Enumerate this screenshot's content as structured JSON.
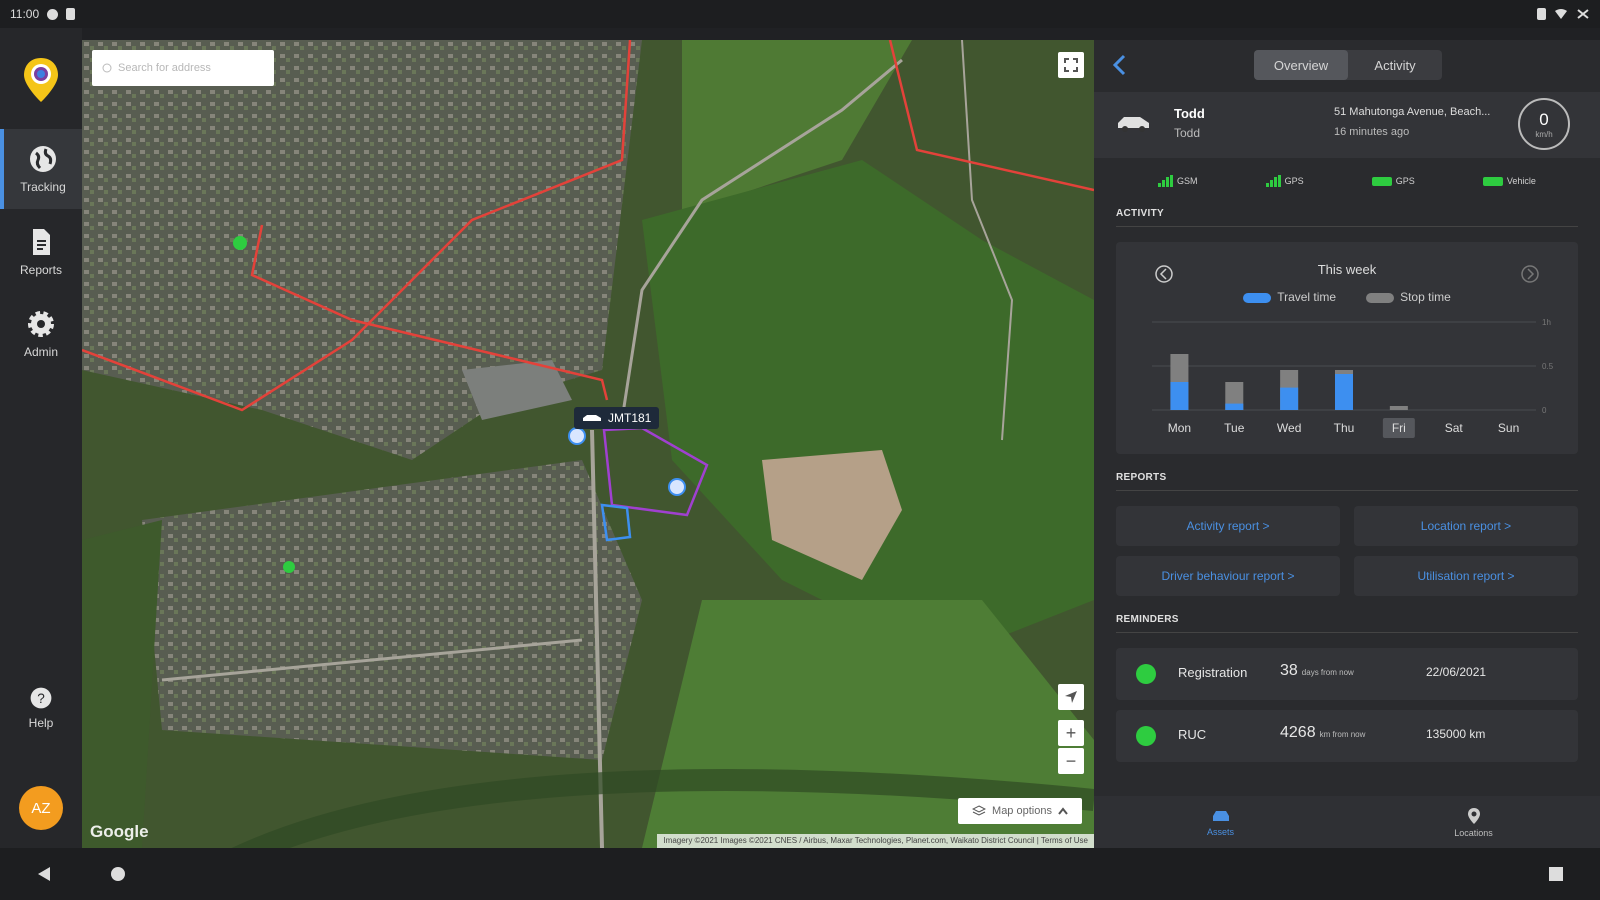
{
  "status_bar": {
    "time": "11:00"
  },
  "rail": {
    "items": [
      {
        "label": "Tracking",
        "icon": "globe-icon",
        "active": true
      },
      {
        "label": "Reports",
        "icon": "document-icon",
        "active": false
      },
      {
        "label": "Admin",
        "icon": "gear-icon",
        "active": false
      }
    ],
    "help": "Help",
    "avatar": "AZ"
  },
  "map": {
    "search_placeholder": "Search for address",
    "vehicle_label": "JMT181",
    "map_options": "Map options",
    "google": "Google",
    "attribution": "Imagery ©2021 Images ©2021 CNES / Airbus, Maxar Technologies, Planet.com, Waikato District Council | Terms of Use"
  },
  "panel": {
    "tabs": [
      "Overview",
      "Activity"
    ],
    "active_tab": "Overview",
    "vehicle": {
      "name": "Todd",
      "sub": "Todd",
      "address": "51 Mahutonga Avenue, Beach...",
      "updated": "16 minutes ago",
      "speed": "0",
      "speed_unit": "km/h"
    },
    "signals": [
      "GSM",
      "GPS",
      "GPS",
      "Vehicle"
    ],
    "activity_title": "ACTIVITY",
    "week_title": "This week",
    "legend": {
      "travel": "Travel time",
      "stop": "Stop time"
    },
    "reports_title": "REPORTS",
    "reports": [
      "Activity report >",
      "Location report >",
      "Driver behaviour report >",
      "Utilisation report >"
    ],
    "reminders_title": "REMINDERS",
    "reminders": [
      {
        "label": "Registration",
        "amount": "38",
        "amount_unit": "days from now",
        "date": "22/06/2021"
      },
      {
        "label": "RUC",
        "amount": "4268",
        "amount_unit": "km from now",
        "date": "135000 km"
      }
    ],
    "bottom_tabs": [
      "Assets",
      "Locations"
    ]
  },
  "chart_data": {
    "type": "bar",
    "title": "This week",
    "categories": [
      "Mon",
      "Tue",
      "Wed",
      "Thu",
      "Fri",
      "Sat",
      "Sun"
    ],
    "highlighted_category": "Fri",
    "series": [
      {
        "name": "Travel time",
        "color": "#3d8ff0",
        "values": [
          0.35,
          0.08,
          0.28,
          0.45,
          0,
          0,
          0
        ]
      },
      {
        "name": "Stop time",
        "color": "#808080",
        "values": [
          0.7,
          0.35,
          0.5,
          0.5,
          0.05,
          0,
          0
        ]
      }
    ],
    "y_ticks": [
      "1h",
      "0.5",
      "0"
    ],
    "ylim": [
      0,
      1.1
    ],
    "stacked": false
  },
  "colors": {
    "accent": "#4a90e2",
    "ok": "#2ecc40",
    "avatar": "#f39c1f"
  }
}
